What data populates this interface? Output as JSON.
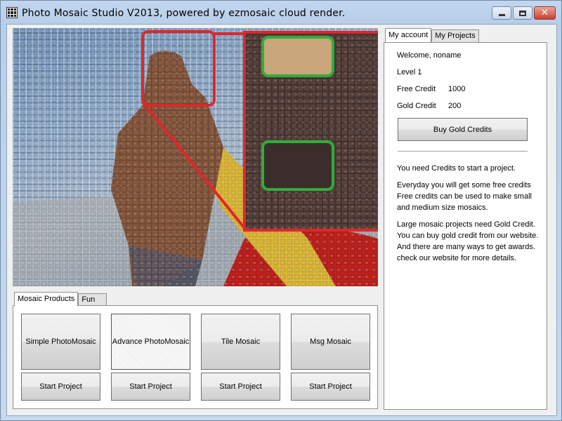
{
  "window": {
    "title": "Photo Mosaic Studio V2013, powered by ezmosaic cloud render.",
    "controls": {
      "minimize": "minimize-icon",
      "maximize": "maximize-icon",
      "close": "close-icon"
    }
  },
  "preview": {
    "description_icon": "mosaic-preview-image",
    "highlight_color": "#e0262b",
    "focus_color": "#2fae3a"
  },
  "products": {
    "tabs": [
      {
        "label": "Mosaic Products"
      },
      {
        "label": "Fun"
      }
    ],
    "items": [
      {
        "label": "Simple PhotoMosaic",
        "start": "Start Project"
      },
      {
        "label": "Advance PhotoMosaic",
        "start": "Start Project"
      },
      {
        "label": "Tile Mosaic",
        "start": "Start Project"
      },
      {
        "label": "Msg Mosaic",
        "start": "Start Project"
      }
    ]
  },
  "account": {
    "tabs": [
      {
        "label": "My account"
      },
      {
        "label": "My Projects"
      }
    ],
    "welcome": "Welcome, noname",
    "level": "Level 1",
    "free_credit_label": "Free Credit",
    "free_credit_value": "1000",
    "gold_credit_label": "Gold Credit",
    "gold_credit_value": "200",
    "buy_button": "Buy Gold Credits",
    "paragraphs": [
      "You need Credits to start a project.",
      "Everyday you will get some free credits",
      "Free credits can be used to make small",
      "and medium size mosaics.",
      "Large mosaic projects need Gold Credit.",
      "You can buy gold credit from our website.",
      "And there are many ways to get awards.",
      "check our website for more details."
    ]
  }
}
